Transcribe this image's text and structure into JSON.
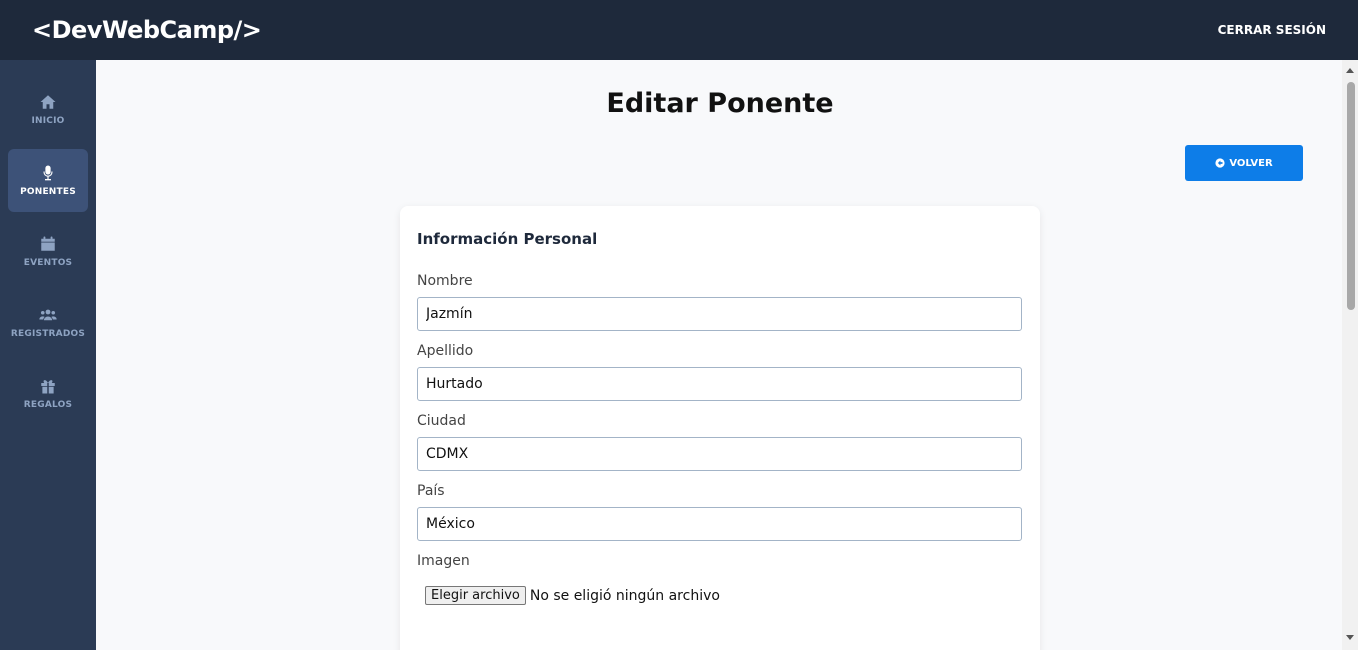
{
  "header": {
    "logo": "<DevWebCamp/>",
    "logout_label": "CERRAR SESIÓN"
  },
  "sidebar": {
    "items": [
      {
        "label": "INICIO",
        "icon": "home-icon",
        "active": false
      },
      {
        "label": "PONENTES",
        "icon": "microphone-icon",
        "active": true
      },
      {
        "label": "EVENTOS",
        "icon": "calendar-icon",
        "active": false
      },
      {
        "label": "REGISTRADOS",
        "icon": "users-icon",
        "active": false
      },
      {
        "label": "REGALOS",
        "icon": "gift-icon",
        "active": false
      }
    ]
  },
  "main": {
    "title": "Editar Ponente",
    "back_label": "VOLVER",
    "card": {
      "title": "Información Personal",
      "fields": [
        {
          "label": "Nombre",
          "value": "Jazmín"
        },
        {
          "label": "Apellido",
          "value": "Hurtado"
        },
        {
          "label": "Ciudad",
          "value": "CDMX"
        },
        {
          "label": "País",
          "value": "México"
        }
      ],
      "image_label": "Imagen",
      "file_button": "Elegir archivo",
      "file_status": "No se eligió ningún archivo"
    }
  },
  "colors": {
    "topbar": "#1e293b",
    "sidebar": "#2b3b55",
    "accent": "#0d7de8"
  }
}
